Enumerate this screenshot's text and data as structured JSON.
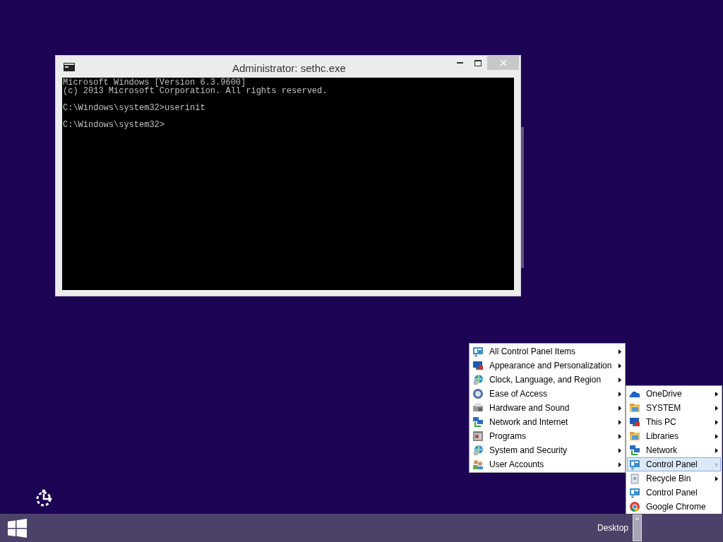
{
  "window": {
    "title": "Administrator: sethc.exe",
    "console_lines": [
      {
        "text": "Microsoft Windows [Version 6.3.9600]",
        "gap_before": false
      },
      {
        "text": "(c) 2013 Microsoft Corporation. All rights reserved.",
        "gap_before": false
      },
      {
        "text": "C:\\Windows\\system32>userinit",
        "gap_before": true
      },
      {
        "text": "C:\\Windows\\system32>",
        "gap_before": true
      }
    ]
  },
  "control_panel_menu": {
    "items": [
      {
        "label": "All Control Panel Items",
        "submenu": true,
        "selected": false
      },
      {
        "label": "Appearance and Personalization",
        "submenu": true,
        "selected": false
      },
      {
        "label": "Clock, Language, and Region",
        "submenu": true,
        "selected": false
      },
      {
        "label": "Ease of Access",
        "submenu": true,
        "selected": false
      },
      {
        "label": "Hardware and Sound",
        "submenu": true,
        "selected": false
      },
      {
        "label": "Network and Internet",
        "submenu": true,
        "selected": false
      },
      {
        "label": "Programs",
        "submenu": true,
        "selected": false
      },
      {
        "label": "System and Security",
        "submenu": true,
        "selected": false
      },
      {
        "label": "User Accounts",
        "submenu": true,
        "selected": false
      }
    ]
  },
  "desktop_menu": {
    "items": [
      {
        "label": "OneDrive",
        "submenu": true,
        "selected": false
      },
      {
        "label": "SYSTEM",
        "submenu": true,
        "selected": false
      },
      {
        "label": "This PC",
        "submenu": true,
        "selected": false
      },
      {
        "label": "Libraries",
        "submenu": true,
        "selected": false
      },
      {
        "label": "Network",
        "submenu": true,
        "selected": false
      },
      {
        "label": "Control Panel",
        "submenu": true,
        "selected": true
      },
      {
        "label": "Recycle Bin",
        "submenu": true,
        "selected": false
      },
      {
        "label": "Control Panel",
        "submenu": false,
        "selected": false
      },
      {
        "label": "Google Chrome",
        "submenu": false,
        "selected": false
      }
    ]
  },
  "taskbar": {
    "toolbar_label": "Desktop",
    "chevron": "»"
  }
}
